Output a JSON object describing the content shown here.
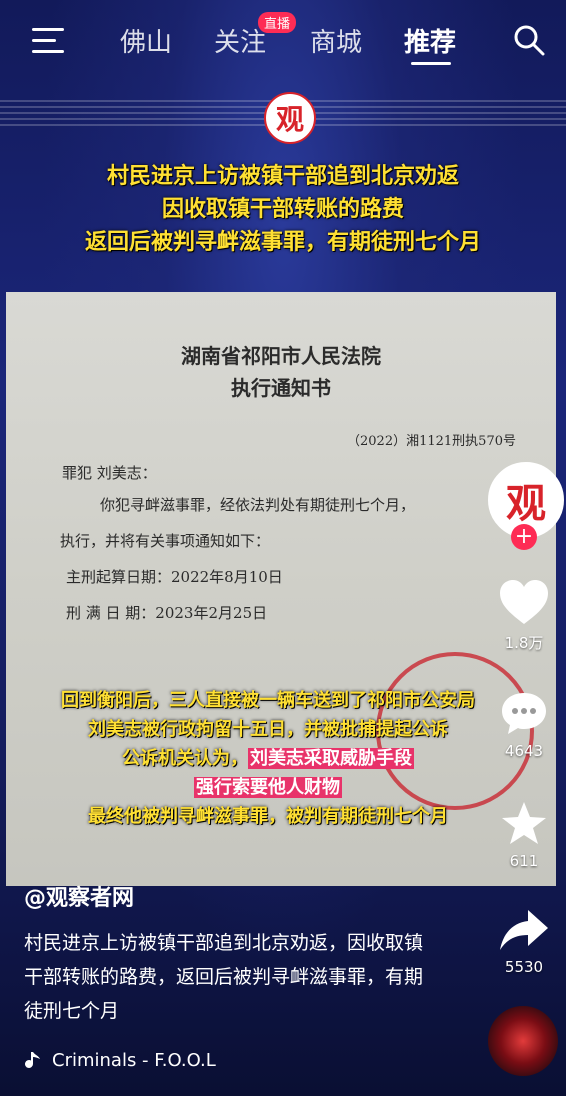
{
  "nav": {
    "tabs": [
      "佛山",
      "关注",
      "商城",
      "推荐"
    ],
    "active_tab": "推荐",
    "live_badge": "直播"
  },
  "video": {
    "logo_char": "观",
    "headline_lines": [
      "村民进京上访被镇干部追到北京劝返",
      "因收取镇干部转账的路费",
      "返回后被判寻衅滋事罪，有期徒刑七个月"
    ],
    "document": {
      "court": "湖南省祁阳市人民法院",
      "title": "执行通知书",
      "case_no": "（2022）湘1121刑执570号",
      "lines": [
        "罪犯  刘美志：",
        "你犯寻衅滋事罪，经依法判处有期徒刑七个月，",
        "执行，并将有关事项通知如下：",
        "主刑起算日期：2022年8月10日",
        "刑  满  日  期：2023年2月25日"
      ]
    },
    "caption_lines": [
      "回到衡阳后，三人直接被一辆车送到了祁阳市公安局",
      "刘美志被行政拘留十五日，并被批捕提起公诉",
      "公诉机关认为，",
      "刘美志采取威胁手段",
      "强行索要他人财物",
      "最终他被判寻衅滋事罪，被判有期徒刑七个月"
    ]
  },
  "actions": {
    "avatar_char": "观",
    "likes": "1.8万",
    "comments": "4643",
    "favorites": "611",
    "shares": "5530"
  },
  "info": {
    "author": "@观察者网",
    "description": "村民进京上访被镇干部追到北京劝返，因收取镇干部转账的路费，返回后被判寻衅滋事罪，有期徒刑七个月",
    "music": "Criminals - F.O.O.L"
  },
  "colors": {
    "caption_yellow": "#ffe033",
    "highlight_pink": "#e8336a",
    "accent_red": "#fe2c55"
  }
}
